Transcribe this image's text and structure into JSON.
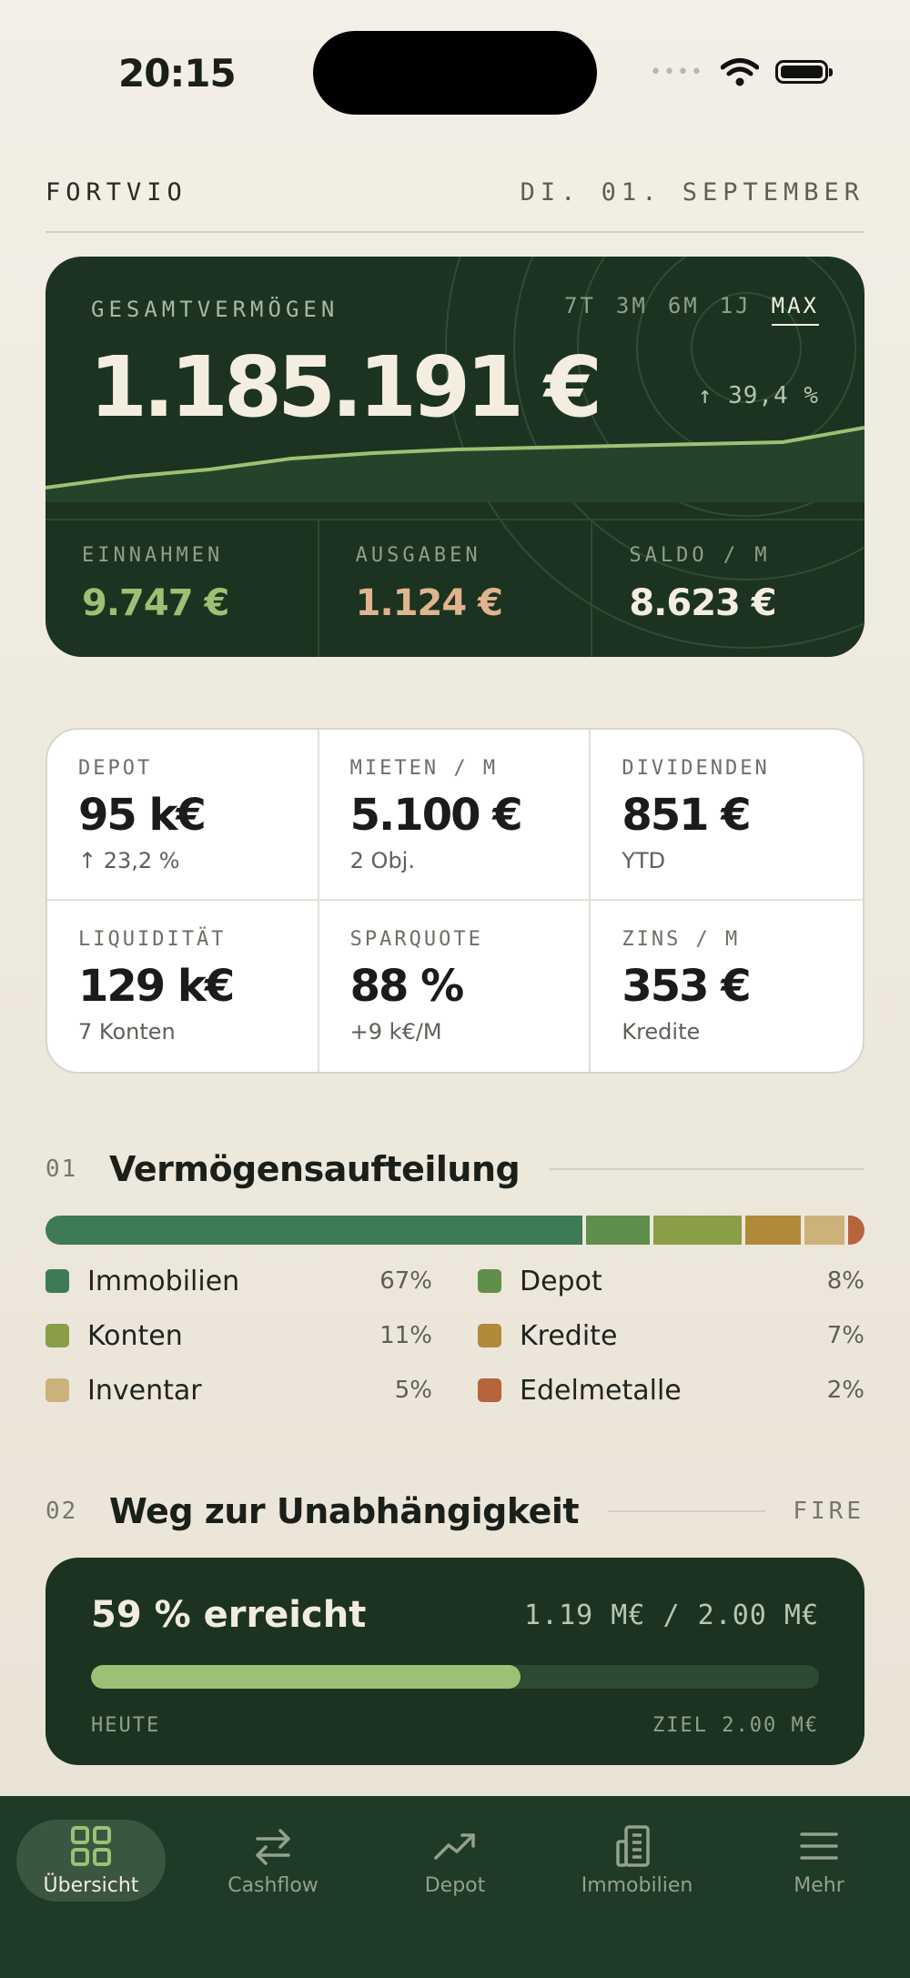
{
  "status_bar": {
    "time": "20:15"
  },
  "header": {
    "brand": "FORTVIO",
    "date": "DI. 01. SEPTEMBER"
  },
  "hero": {
    "label": "GESAMTVERMÖGEN",
    "value": "1.185.191 €",
    "ranges": [
      "7T",
      "3M",
      "6M",
      "1J",
      "MAX"
    ],
    "active_range": "MAX",
    "change": "↑ 39,4 %",
    "stats": [
      {
        "label": "EINNAHMEN",
        "value": "9.747 €",
        "color": "#9cc174"
      },
      {
        "label": "AUSGABEN",
        "value": "1.124 €",
        "color": "#e0b48e"
      },
      {
        "label": "SALDO / M",
        "value": "8.623 €",
        "color": "#f3eee0"
      }
    ]
  },
  "kpis": [
    {
      "label": "DEPOT",
      "value": "95 k€",
      "sub": "↑ 23,2 %"
    },
    {
      "label": "MIETEN / M",
      "value": "5.100 €",
      "sub": "2 Obj."
    },
    {
      "label": "DIVIDENDEN",
      "value": "851 €",
      "sub": "YTD"
    },
    {
      "label": "LIQUIDITÄT",
      "value": "129 k€",
      "sub": "7 Konten"
    },
    {
      "label": "SPARQUOTE",
      "value": "88 %",
      "sub": "+9 k€/M"
    },
    {
      "label": "ZINS / M",
      "value": "353 €",
      "sub": "Kredite"
    }
  ],
  "allocation": {
    "num": "01",
    "title": "Vermögensaufteilung",
    "items": [
      {
        "name": "Immobilien",
        "pct": "67%",
        "share": 67,
        "color": "#3e7a55"
      },
      {
        "name": "Depot",
        "pct": "8%",
        "share": 8,
        "color": "#5f8f4a"
      },
      {
        "name": "Konten",
        "pct": "11%",
        "share": 11,
        "color": "#8a9e48"
      },
      {
        "name": "Kredite",
        "pct": "7%",
        "share": 7,
        "color": "#b08a3a"
      },
      {
        "name": "Inventar",
        "pct": "5%",
        "share": 5,
        "color": "#cbb27a"
      },
      {
        "name": "Edelmetalle",
        "pct": "2%",
        "share": 2,
        "color": "#b5643c"
      }
    ]
  },
  "fire": {
    "num": "02",
    "title": "Weg zur Unabhängigkeit",
    "tag": "FIRE",
    "headline": "59 % erreicht",
    "amount": "1.19 M€ / 2.00 M€",
    "progress": 0.59,
    "left_label": "HEUTE",
    "right_label": "ZIEL 2.00 M€"
  },
  "tabbar": {
    "tabs": [
      {
        "label": "Übersicht",
        "icon": "grid-icon",
        "active": true
      },
      {
        "label": "Cashflow",
        "icon": "arrows-exchange-icon",
        "active": false
      },
      {
        "label": "Depot",
        "icon": "trend-up-icon",
        "active": false
      },
      {
        "label": "Immobilien",
        "icon": "building-icon",
        "active": false
      },
      {
        "label": "Mehr",
        "icon": "menu-icon",
        "active": false
      }
    ]
  },
  "colors": {
    "forest": "#1c3321",
    "accent_green": "#9cc174",
    "background": "#f2efe6"
  }
}
